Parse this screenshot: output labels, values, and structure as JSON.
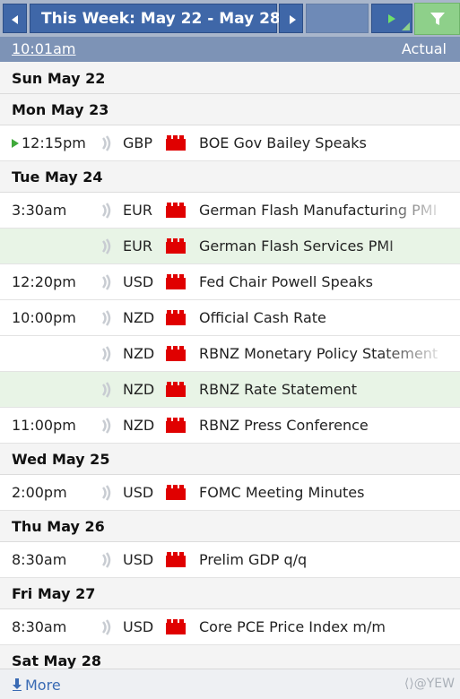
{
  "toolbar": {
    "title": "This Week: May 22 - May 28",
    "filter_color": "#8ed08a"
  },
  "subheader": {
    "time": "10:01am",
    "actual_label": "Actual"
  },
  "days": [
    {
      "label": "Sun May 22",
      "events": []
    },
    {
      "label": "Mon May 23",
      "events": [
        {
          "time": "12:15pm",
          "currency": "GBP",
          "name": "BOE Gov Bailey Speaks",
          "highlight": false,
          "marked": true,
          "fade": false
        }
      ]
    },
    {
      "label": "Tue May 24",
      "events": [
        {
          "time": "3:30am",
          "currency": "EUR",
          "name": "German Flash Manufacturing PMI",
          "highlight": false,
          "marked": false,
          "fade": true
        },
        {
          "time": "",
          "currency": "EUR",
          "name": "German Flash Services PMI",
          "highlight": true,
          "marked": false,
          "fade": true
        },
        {
          "time": "12:20pm",
          "currency": "USD",
          "name": "Fed Chair Powell Speaks",
          "highlight": false,
          "marked": false,
          "fade": false
        },
        {
          "time": "10:00pm",
          "currency": "NZD",
          "name": "Official Cash Rate",
          "highlight": false,
          "marked": false,
          "fade": false
        },
        {
          "time": "",
          "currency": "NZD",
          "name": "RBNZ Monetary Policy Statement",
          "highlight": false,
          "marked": false,
          "fade": true
        },
        {
          "time": "",
          "currency": "NZD",
          "name": "RBNZ Rate Statement",
          "highlight": true,
          "marked": false,
          "fade": false
        },
        {
          "time": "11:00pm",
          "currency": "NZD",
          "name": "RBNZ Press Conference",
          "highlight": false,
          "marked": false,
          "fade": false
        }
      ]
    },
    {
      "label": "Wed May 25",
      "events": [
        {
          "time": "2:00pm",
          "currency": "USD",
          "name": "FOMC Meeting Minutes",
          "highlight": false,
          "marked": false,
          "fade": false
        }
      ]
    },
    {
      "label": "Thu May 26",
      "events": [
        {
          "time": "8:30am",
          "currency": "USD",
          "name": "Prelim GDP q/q",
          "highlight": false,
          "marked": false,
          "fade": false
        }
      ]
    },
    {
      "label": "Fri May 27",
      "events": [
        {
          "time": "8:30am",
          "currency": "USD",
          "name": "Core PCE Price Index m/m",
          "highlight": false,
          "marked": false,
          "fade": true
        }
      ]
    },
    {
      "label": "Sat May 28",
      "events": []
    }
  ],
  "icons": {
    "impact": "high-impact-folder-icon",
    "impact_color": "#e00000",
    "speaker": "sound-icon"
  },
  "footer": {
    "more_label": "More",
    "watermark": "⟨⟩@YEW"
  }
}
